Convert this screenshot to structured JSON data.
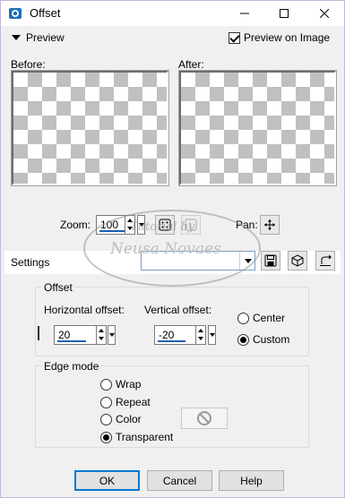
{
  "window": {
    "title": "Offset",
    "controls": {
      "minimize": "minimize-icon",
      "maximize": "maximize-icon",
      "close": "close-icon"
    }
  },
  "preview": {
    "toggle_label": "Preview",
    "preview_on_image_label": "Preview on Image",
    "preview_on_image_checked": true,
    "before_label": "Before:",
    "after_label": "After:",
    "zoom_label": "Zoom:",
    "zoom_value": "100",
    "pan_label": "Pan:"
  },
  "settings": {
    "label": "Settings",
    "preset_value": ""
  },
  "offset": {
    "group_label": "Offset",
    "horizontal_label": "Horizontal offset:",
    "horizontal_value": "20",
    "vertical_label": "Vertical offset:",
    "vertical_value": "-20",
    "link_checked": false,
    "mode_options": [
      {
        "label": "Center",
        "selected": false
      },
      {
        "label": "Custom",
        "selected": true
      }
    ]
  },
  "edge_mode": {
    "group_label": "Edge mode",
    "options": [
      {
        "label": "Wrap",
        "selected": false
      },
      {
        "label": "Repeat",
        "selected": false
      },
      {
        "label": "Color",
        "selected": false
      },
      {
        "label": "Transparent",
        "selected": true
      }
    ]
  },
  "buttons": {
    "ok": "OK",
    "cancel": "Cancel",
    "help": "Help"
  },
  "watermark": {
    "line1": "Tutorial by",
    "line2": "Neusa Novaes"
  },
  "colors": {
    "accent": "#0078d7",
    "input_underline": "#1a5fb4",
    "checker": "#c0c0c0"
  }
}
